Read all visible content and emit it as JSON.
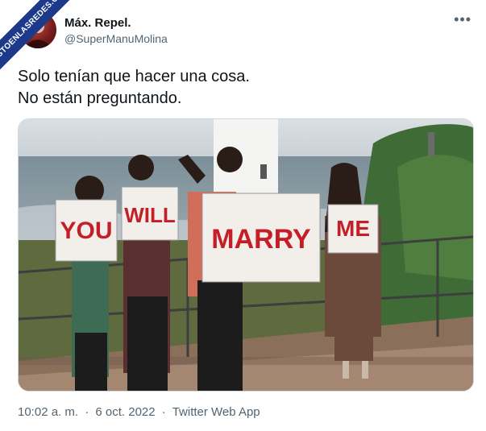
{
  "watermark": {
    "text": "VISTOENLASREDES.COM"
  },
  "tweet": {
    "display_name": "Máx. Repel.",
    "handle": "@SuperManuMolina",
    "more_icon": "more-horizontal-icon",
    "lines": [
      "Solo tenían que hacer una cosa.",
      "No están preguntando."
    ],
    "signs": [
      "YOU",
      "WILL",
      "MARRY",
      "ME"
    ],
    "time": "10:02 a. m.",
    "sep1": "·",
    "date": "6 oct. 2022",
    "sep2": "·",
    "source": "Twitter Web App"
  }
}
